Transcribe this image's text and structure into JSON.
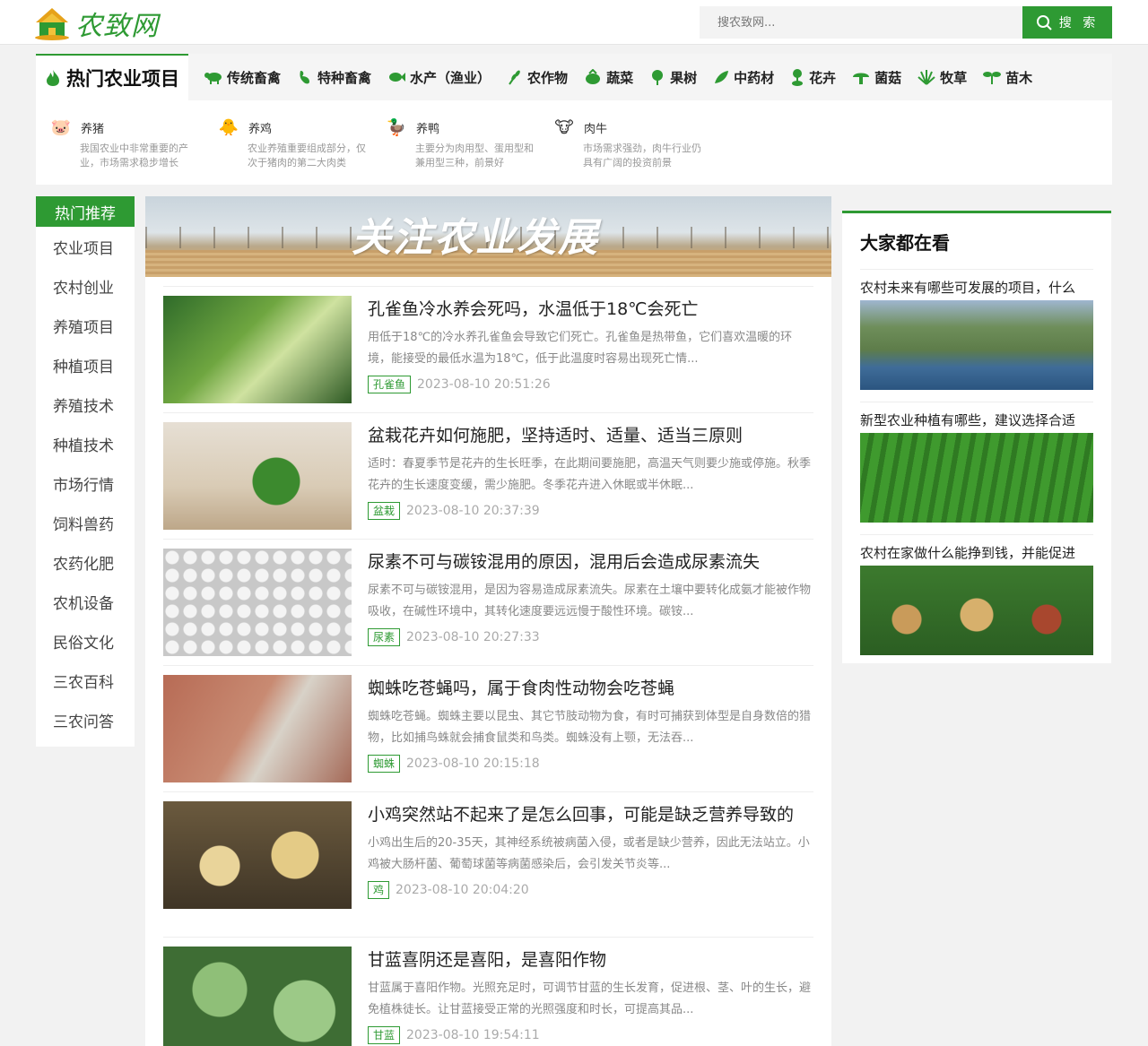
{
  "header": {
    "logo_text": "农致网",
    "search": {
      "placeholder": "搜农致网...",
      "button_label": "搜 索"
    }
  },
  "categories": {
    "title": "热门农业项目",
    "items": [
      {
        "label": "传统畜禽",
        "icon": "cow-icon"
      },
      {
        "label": "特种畜禽",
        "icon": "rooster-icon"
      },
      {
        "label": "水产（渔业）",
        "icon": "fish-icon"
      },
      {
        "label": "农作物",
        "icon": "grain-icon"
      },
      {
        "label": "蔬菜",
        "icon": "vegetable-icon"
      },
      {
        "label": "果树",
        "icon": "fruit-tree-icon"
      },
      {
        "label": "中药材",
        "icon": "herb-icon"
      },
      {
        "label": "花卉",
        "icon": "flower-icon"
      },
      {
        "label": "菌菇",
        "icon": "mushroom-icon"
      },
      {
        "label": "牧草",
        "icon": "grass-icon"
      },
      {
        "label": "苗木",
        "icon": "seedling-icon"
      }
    ],
    "subcategories": [
      {
        "label": "养猪",
        "emoji": "🐷",
        "desc": "我国农业中非常重要的产业，市场需求稳步增长"
      },
      {
        "label": "养鸡",
        "emoji": "🐥",
        "desc": "农业养殖重要组成部分，仅次于猪肉的第二大肉类"
      },
      {
        "label": "养鸭",
        "emoji": "🦆",
        "desc": "主要分为肉用型、蛋用型和兼用型三种，前景好"
      },
      {
        "label": "肉牛",
        "emoji": "🐮",
        "desc": "市场需求强劲，肉牛行业仍具有广阔的投资前景"
      }
    ]
  },
  "sidebar": {
    "title": "热门推荐",
    "items": [
      "农业项目",
      "农村创业",
      "养殖项目",
      "种植项目",
      "养殖技术",
      "种植技术",
      "市场行情",
      "饲料兽药",
      "农药化肥",
      "农机设备",
      "民俗文化",
      "三农百科",
      "三农问答"
    ]
  },
  "banner": {
    "text": "关注农业发展"
  },
  "articles": [
    {
      "title": "孔雀鱼冷水养会死吗，水温低于18℃会死亡",
      "desc": "用低于18℃的冷水养孔雀鱼会导致它们死亡。孔雀鱼是热带鱼，它们喜欢温暖的环境，能接受的最低水温为18℃，低于此温度时容易出现死亡情...",
      "tag": "孔雀鱼",
      "time": "2023-08-10 20:51:26"
    },
    {
      "title": "盆栽花卉如何施肥，坚持适时、适量、适当三原则",
      "desc": "适时：春夏季节是花卉的生长旺季，在此期间要施肥，高温天气则要少施或停施。秋季花卉的生长速度变缓，需少施肥。冬季花卉进入休眠或半休眠...",
      "tag": "盆栽",
      "time": "2023-08-10 20:37:39"
    },
    {
      "title": "尿素不可与碳铵混用的原因，混用后会造成尿素流失",
      "desc": "尿素不可与碳铵混用，是因为容易造成尿素流失。尿素在土壤中要转化成氨才能被作物吸收，在碱性环境中，其转化速度要远远慢于酸性环境。碳铵...",
      "tag": "尿素",
      "time": "2023-08-10 20:27:33"
    },
    {
      "title": "蜘蛛吃苍蝇吗，属于食肉性动物会吃苍蝇",
      "desc": "蜘蛛吃苍蝇。蜘蛛主要以昆虫、其它节肢动物为食，有时可捕获到体型是自身数倍的猎物，比如捕鸟蛛就会捕食鼠类和鸟类。蜘蛛没有上颚，无法吞...",
      "tag": "蜘蛛",
      "time": "2023-08-10 20:15:18"
    },
    {
      "title": "小鸡突然站不起来了是怎么回事，可能是缺乏营养导致的",
      "desc": "小鸡出生后的20-35天，其神经系统被病菌入侵，或者是缺少营养，因此无法站立。小鸡被大肠杆菌、葡萄球菌等病菌感染后，会引发关节炎等...",
      "tag": "鸡",
      "time": "2023-08-10 20:04:20"
    },
    {
      "title": "甘蓝喜阴还是喜阳，是喜阳作物",
      "desc": "甘蓝属于喜阳作物。光照充足时，可调节甘蓝的生长发育，促进根、茎、叶的生长，避免植株徒长。让甘蓝接受正常的光照强度和时长，可提高其品...",
      "tag": "甘蓝",
      "time": "2023-08-10 19:54:11"
    }
  ],
  "right": {
    "title": "大家都在看",
    "items": [
      {
        "title": "农村未来有哪些可发展的项目，什么"
      },
      {
        "title": "新型农业种植有哪些，建议选择合适"
      },
      {
        "title": "农村在家做什么能挣到钱，并能促进"
      }
    ]
  },
  "colors": {
    "brand": "#2e9a33"
  }
}
